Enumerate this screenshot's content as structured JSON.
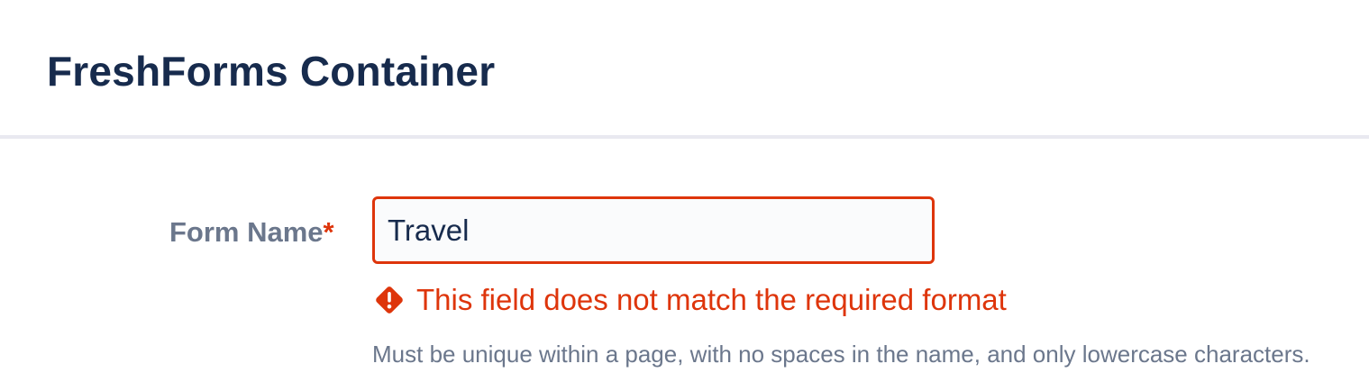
{
  "dialog": {
    "title": "FreshForms Container"
  },
  "form": {
    "name_field": {
      "label": "Form Name",
      "required_marker": "*",
      "value": "Travel",
      "error_message": "This field does not match the required format",
      "helper_text": "Must be unique within a page, with no spaces in the name, and only lowercase characters."
    }
  },
  "icons": {
    "error": "warning-diamond-icon"
  },
  "colors": {
    "title": "#172b4d",
    "label": "#6b778c",
    "error": "#de350b",
    "input_background": "#fafbfc",
    "divider": "#e9e9f0"
  }
}
